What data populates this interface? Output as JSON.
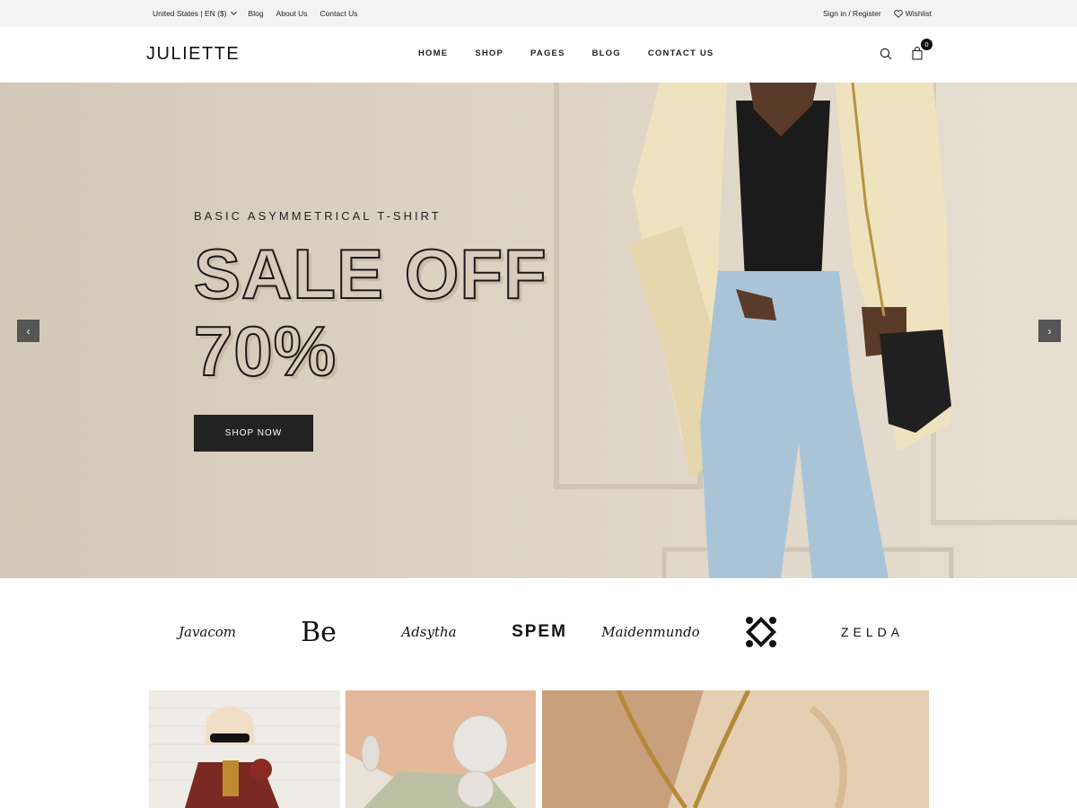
{
  "topbar": {
    "locale": "United States | EN ($)",
    "links": [
      "Blog",
      "About Us",
      "Contact Us"
    ],
    "account": "Sign in / Register",
    "wishlist": "Wishlist"
  },
  "header": {
    "logo": "JULIETTE",
    "nav": [
      "HOME",
      "SHOP",
      "PAGES",
      "BLOG",
      "CONTACT US"
    ],
    "cart_count": "0"
  },
  "hero": {
    "subtitle": "BASIC ASYMMETRICAL T-SHIRT",
    "title_line1": "SALE OFF",
    "title_line2": "70%",
    "button": "SHOP NOW",
    "prev_arrow": "‹",
    "next_arrow": "›"
  },
  "brands": [
    "Javacom",
    "Be",
    "Adsytha",
    "SPEM",
    "Maidenmundo",
    "",
    "ZELDA"
  ],
  "colors": {
    "topbar_bg": "#f3f3f3",
    "hero_bg": "#d6cdbd",
    "button_bg": "#222222",
    "arrow_bg": "#555555"
  }
}
